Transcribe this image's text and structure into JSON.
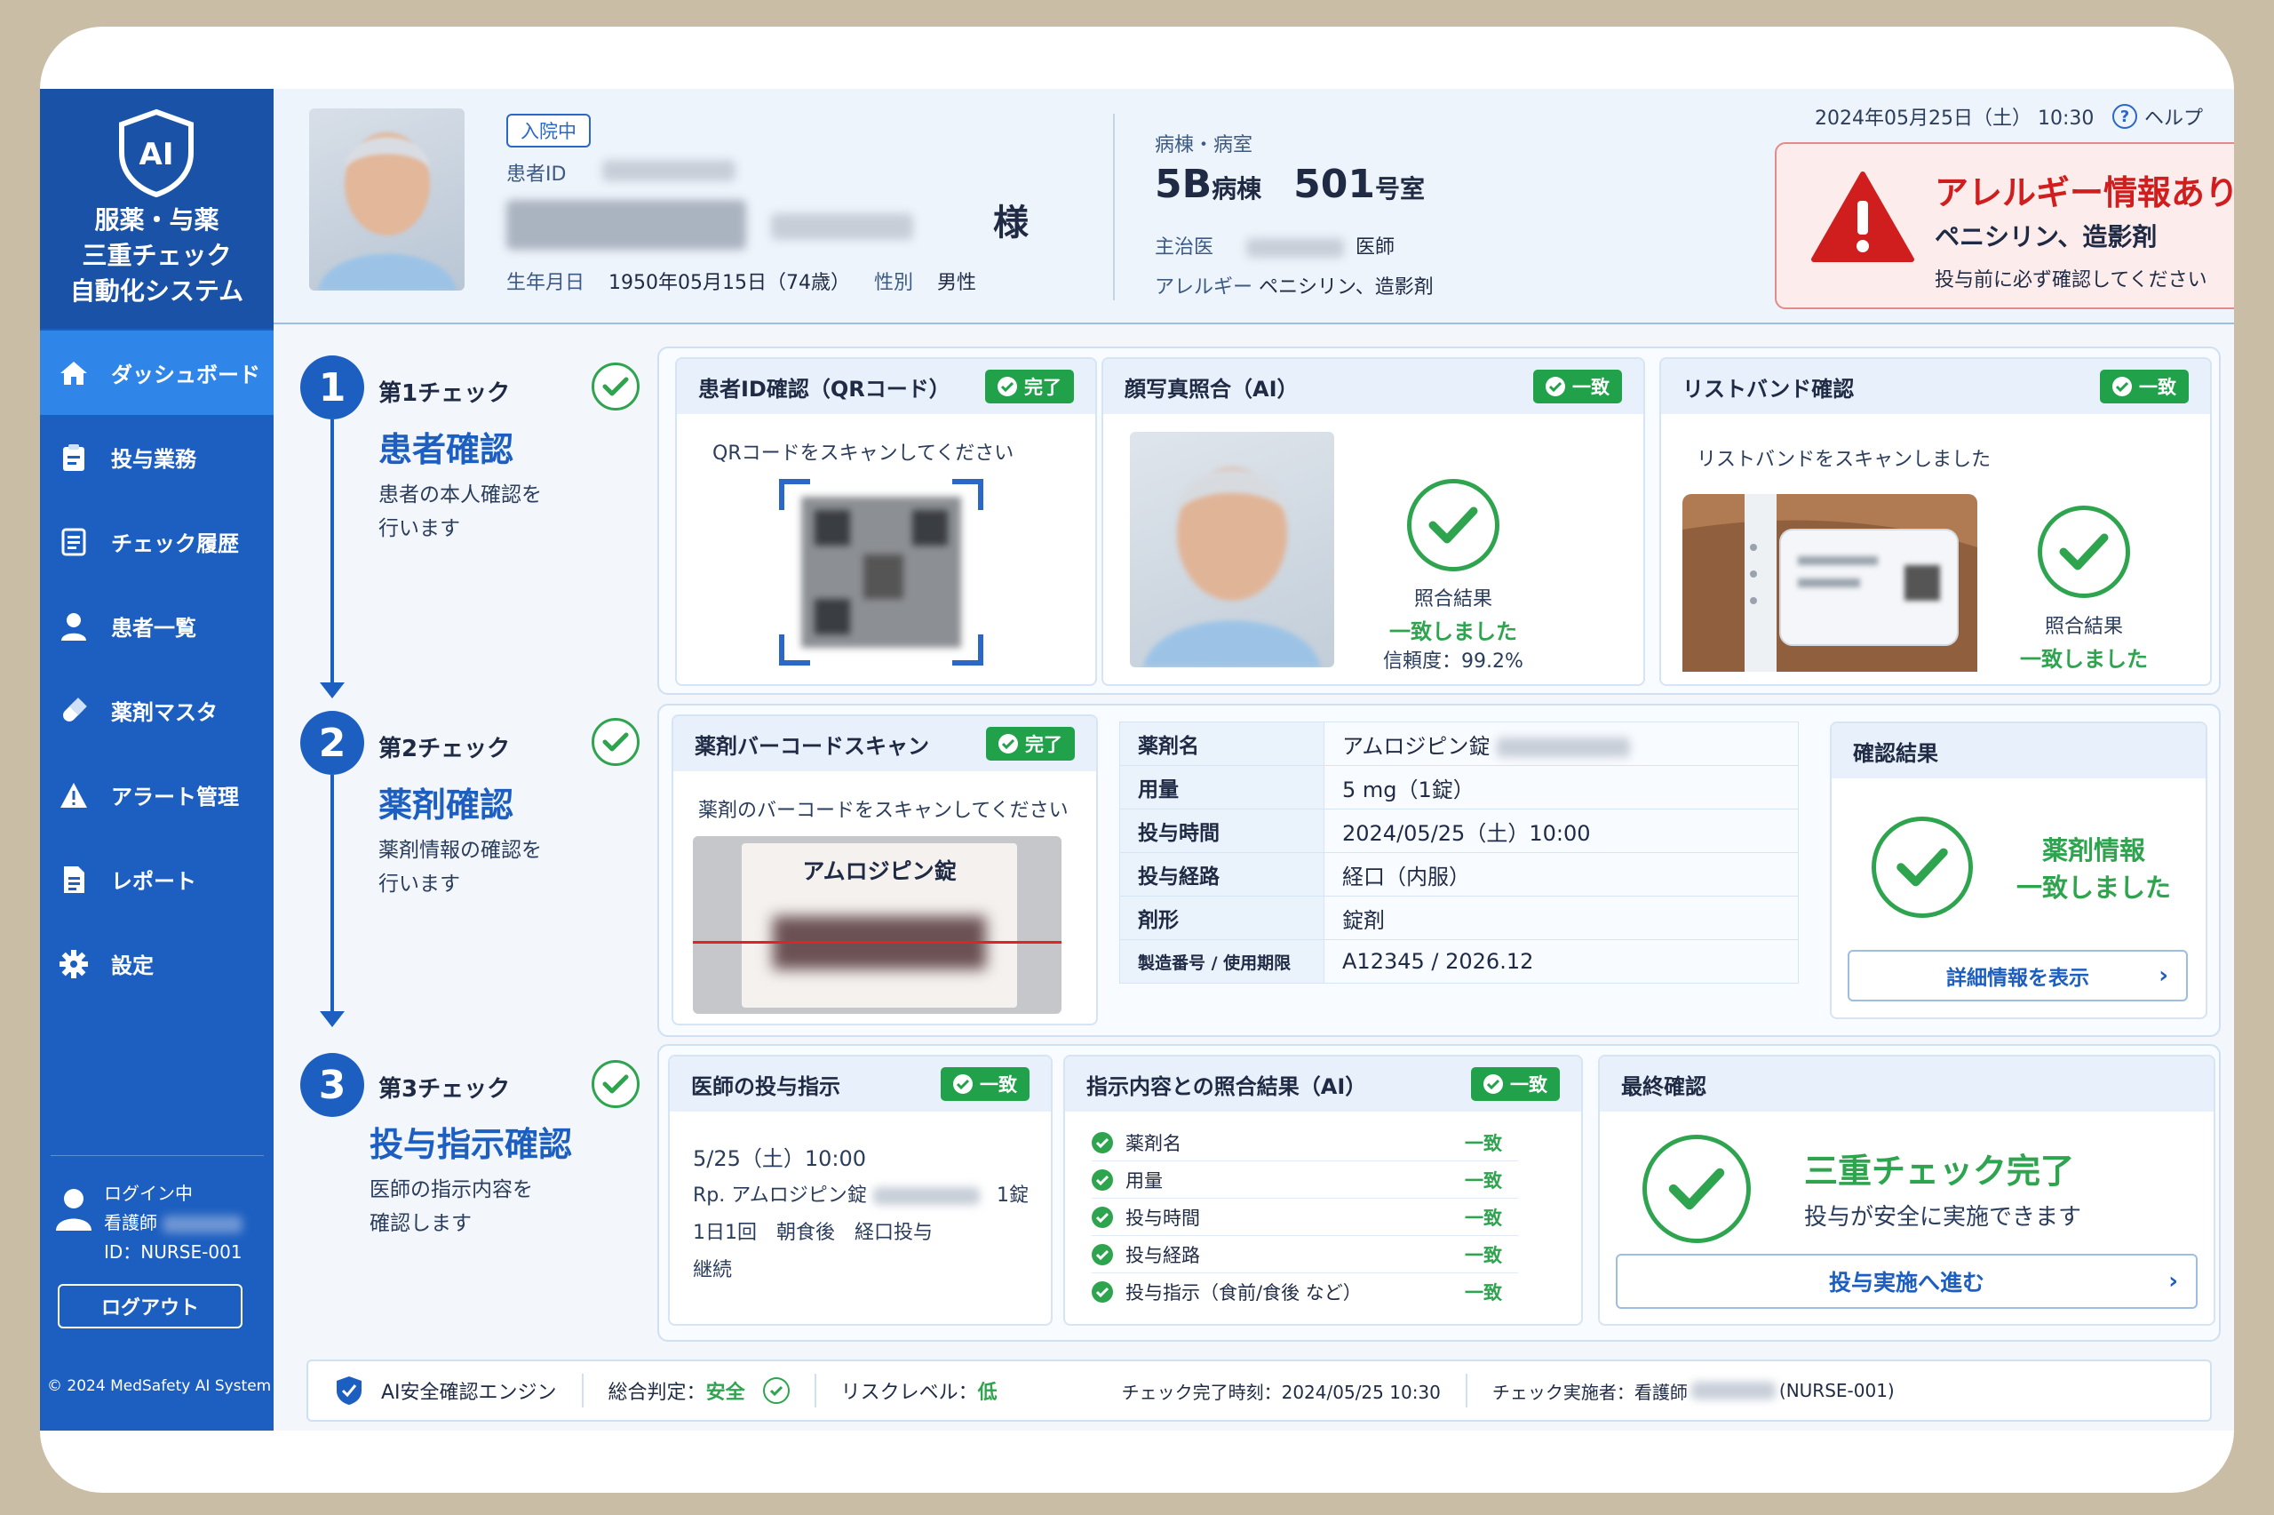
{
  "app": {
    "title_lines": "服薬・与薬\n三重チェック\n自動化システム",
    "logo_text": "AI"
  },
  "nav": [
    {
      "label": "ダッシュボード",
      "icon": "home-icon",
      "active": true
    },
    {
      "label": "投与業務",
      "icon": "clipboard-icon"
    },
    {
      "label": "チェック履歴",
      "icon": "list-icon"
    },
    {
      "label": "患者一覧",
      "icon": "user-icon"
    },
    {
      "label": "薬剤マスタ",
      "icon": "pill-icon"
    },
    {
      "label": "アラート管理",
      "icon": "warning-icon"
    },
    {
      "label": "レポート",
      "icon": "document-icon"
    },
    {
      "label": "設定",
      "icon": "gear-icon"
    }
  ],
  "user": {
    "status": "ログイン中",
    "role": "看護師",
    "id": "ID：NURSE-001",
    "logout": "ログアウト"
  },
  "copyright": "© 2024 MedSafety AI System",
  "patient": {
    "status": "入院中",
    "id_label": "患者ID",
    "honorific": "様",
    "dob_label": "生年月日",
    "dob": "1950年05月15日（74歳）",
    "sex_label": "性別",
    "sex": "男性",
    "ward_label": "病棟・病室",
    "ward": "5B",
    "ward_unit": "病棟",
    "room": "501",
    "room_unit": "号室",
    "doctor_label": "主治医",
    "doctor_suffix": "医師",
    "allergy_label": "アレルギー",
    "allergy": "ペニシリン、造影剤"
  },
  "header": {
    "datetime": "2024年05月25日（土） 10:30",
    "help": "ヘルプ"
  },
  "alert": {
    "title": "アレルギー情報あり",
    "items": "ペニシリン、造影剤",
    "note": "投与前に必ず確認してください"
  },
  "step1": {
    "num": "1",
    "kicker": "第1チェック",
    "title": "患者確認",
    "desc": "患者の本人確認を\n行います",
    "qr": {
      "title": "患者ID確認（QRコード）",
      "tag": "完了",
      "instruction": "QRコードをスキャンしてください"
    },
    "face": {
      "title": "顔写真照合（AI）",
      "tag": "一致",
      "result_label": "照合結果",
      "result": "一致しました",
      "confidence": "信頼度：99.2%"
    },
    "band": {
      "title": "リストバンド確認",
      "tag": "一致",
      "instruction": "リストバンドをスキャンしました",
      "result_label": "照合結果",
      "result": "一致しました"
    }
  },
  "step2": {
    "num": "2",
    "kicker": "第2チェック",
    "title": "薬剤確認",
    "desc": "薬剤情報の確認を\n行います",
    "scan": {
      "title": "薬剤バーコードスキャン",
      "tag": "完了",
      "instruction": "薬剤のバーコードをスキャンしてください",
      "label": "アムロジピン錠"
    },
    "table": [
      {
        "k": "薬剤名",
        "v": "アムロジピン錠"
      },
      {
        "k": "用量",
        "v": "5 mg（1錠）"
      },
      {
        "k": "投与時間",
        "v": "2024/05/25（土）10:00"
      },
      {
        "k": "投与経路",
        "v": "経口（内服）"
      },
      {
        "k": "剤形",
        "v": "錠剤"
      },
      {
        "k": "製造番号 / 使用期限",
        "v": "A12345 / 2026.12"
      }
    ],
    "result": {
      "title": "確認結果",
      "line1": "薬剤情報",
      "line2": "一致しました",
      "button": "詳細情報を表示"
    }
  },
  "step3": {
    "num": "3",
    "kicker": "第3チェック",
    "title": "投与指示確認",
    "desc": "医師の指示内容を\n確認します",
    "order": {
      "title": "医師の投与指示",
      "tag": "一致",
      "time": "5/25（土）10:00",
      "rp": "Rp. アムロジピン錠",
      "qty": "1錠",
      "freq": "1日1回　朝食後　経口投与",
      "cont": "継続"
    },
    "ai": {
      "title": "指示内容との照合結果（AI）",
      "tag": "一致",
      "rows": [
        {
          "k": "薬剤名",
          "v": "一致"
        },
        {
          "k": "用量",
          "v": "一致"
        },
        {
          "k": "投与時間",
          "v": "一致"
        },
        {
          "k": "投与経路",
          "v": "一致"
        },
        {
          "k": "投与指示（食前/食後 など）",
          "v": "一致"
        }
      ]
    },
    "final": {
      "title": "最終確認",
      "line1": "三重チェック完了",
      "line2": "投与が安全に実施できます",
      "button": "投与実施へ進む"
    }
  },
  "footer": {
    "engine": "AI安全確認エンジン",
    "judgement_label": "総合判定：",
    "judgement": "安全",
    "risk_label": "リスクレベル：",
    "risk": "低",
    "time": "チェック完了時刻：2024/05/25 10:30",
    "operator_label": "チェック実施者：看護師",
    "operator_id": "(NURSE-001)"
  },
  "colors": {
    "primary": "#1d5fc0",
    "success": "#21a14a",
    "danger": "#d01e1e"
  }
}
